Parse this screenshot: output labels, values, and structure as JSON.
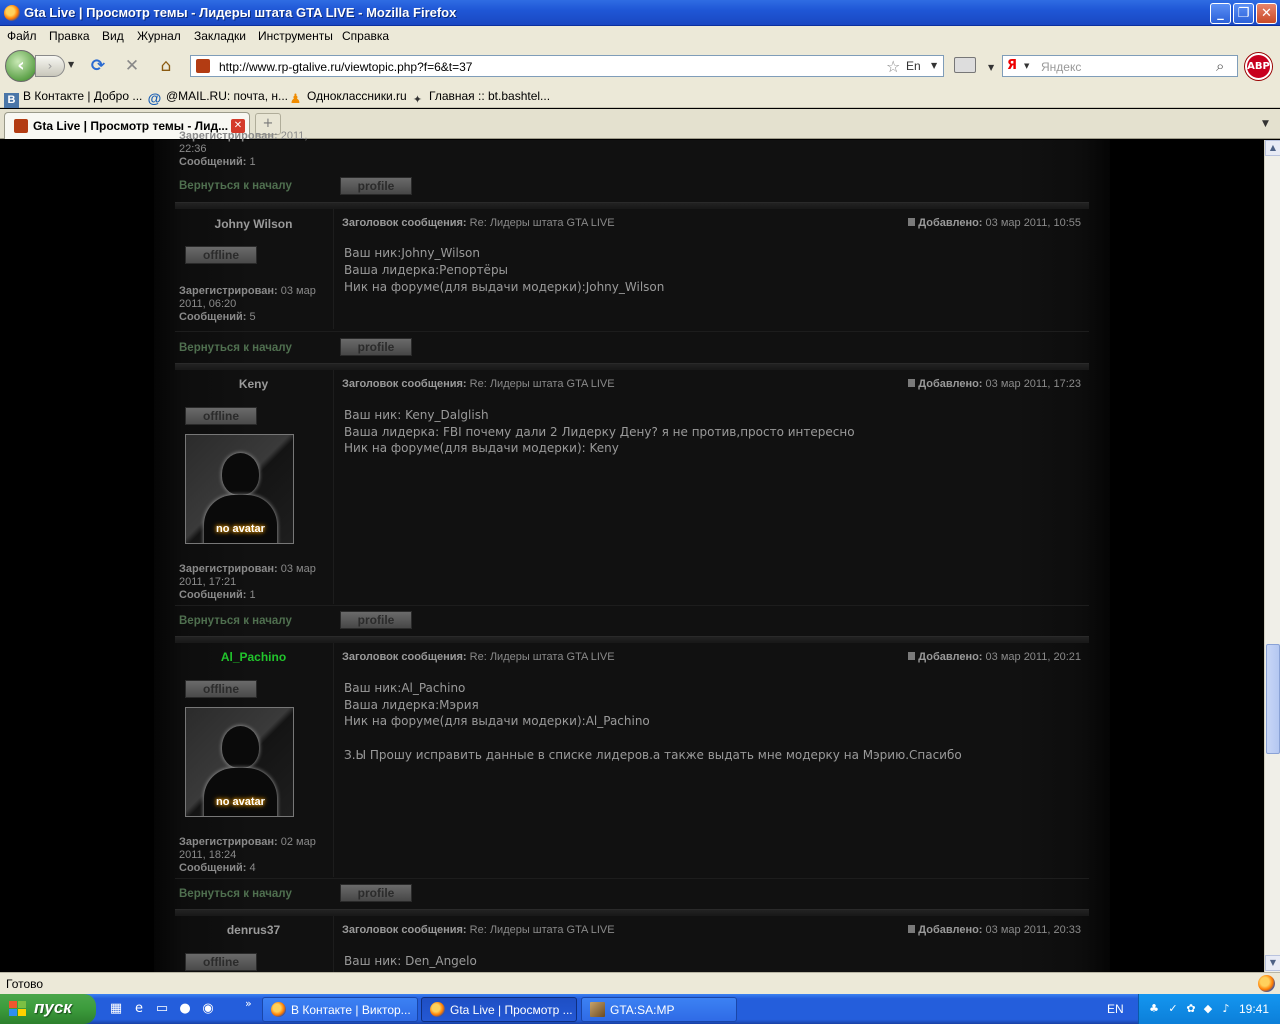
{
  "window": {
    "title": "Gta Live | Просмотр темы - Лидеры штата GTA LIVE - Mozilla Firefox",
    "min": "_",
    "max": "❐",
    "close": "✕"
  },
  "menu": [
    "Файл",
    "Правка",
    "Вид",
    "Журнал",
    "Закладки",
    "Инструменты",
    "Справка"
  ],
  "nav": {
    "url": "http://www.rp-gtalive.ru/viewtopic.php?f=6&t=37",
    "lang_badge": "En",
    "search_placeholder": "Яндекс",
    "search_engine_glyph": "Я",
    "abp": "ABP"
  },
  "bookmarks": [
    {
      "icon": "vk-icon",
      "glyph": "B",
      "label": "В Контакте | Добро ..."
    },
    {
      "icon": "mail-icon",
      "glyph": "@",
      "label": "@MAIL.RU: почта, н..."
    },
    {
      "icon": "odnoklassniki-icon",
      "glyph": "♟",
      "label": "Однокласcники.ru"
    },
    {
      "icon": "bt-icon",
      "glyph": "✦",
      "label": "Главная :: bt.bashtel..."
    }
  ],
  "tab": {
    "label": "Gta Live | Просмотр темы - Лид...",
    "close": "✕",
    "new": "+"
  },
  "forum": {
    "back_to_top": "Вернуться к началу",
    "profile_btn": "profile",
    "offline_btn": "offline",
    "subject_label": "Заголовок сообщения:",
    "added_label": "Добавлено:",
    "registered_label": "Зарегистрирован:",
    "messages_label": "Сообщений:",
    "no_avatar": "no avatar",
    "prev_post": {
      "reg_date_tail": "2011, 22:36",
      "messages": "1"
    },
    "posts": [
      {
        "author": "Johny Wilson",
        "online_color": "gray",
        "subject": "Re: Лидеры штата GTA LIVE",
        "date": "03 мар 2011, 10:55",
        "reg_date": "03 мар 2011, 06:20",
        "messages": "5",
        "lines": [
          "Ваш ник:Johny_Wilson",
          "Ваша лидерка:Репортёры",
          "Ник на форуме(для выдачи модерки):Johny_Wilson"
        ]
      },
      {
        "author": "Keny",
        "online_color": "gray",
        "subject": "Re: Лидеры штата GTA LIVE",
        "date": "03 мар 2011, 17:23",
        "reg_date": "03 мар 2011, 17:21",
        "messages": "1",
        "lines": [
          "Ваш ник: Keny_Dalglish",
          "Ваша лидерка: FBI почему дали 2 Лидерку Дену? я не против,просто интересно",
          "Ник на форуме(для выдачи модерки): Keny"
        ]
      },
      {
        "author": "Al_Pachino",
        "online_color": "green",
        "subject": "Re: Лидеры штата GTA LIVE",
        "date": "03 мар 2011, 20:21",
        "reg_date": "02 мар 2011, 18:24",
        "messages": "4",
        "lines": [
          "Ваш ник:Al_Pachino",
          "Ваша лидерка:Мэрия",
          "Ник на форуме(для выдачи модерки):Al_Pachino",
          "",
          "З.Ы Прошу исправить данные в списке лидеров.а также выдать мне модерку на Мэрию.Спасибо"
        ]
      },
      {
        "author": "denrus37",
        "online_color": "gray",
        "subject": "Re: Лидеры штата GTA LIVE",
        "date": "03 мар 2011, 20:33",
        "lines": [
          "Ваш ник: Den_Angelo"
        ]
      }
    ]
  },
  "status": {
    "text": "Готово"
  },
  "taskbar": {
    "start": "пуск",
    "tasks": [
      "В Контакте | Виктор...",
      "Gta Live | Просмотр ...",
      "GTA:SA:MP"
    ],
    "lang": "EN",
    "clock": "19:41",
    "chevron": "»"
  }
}
